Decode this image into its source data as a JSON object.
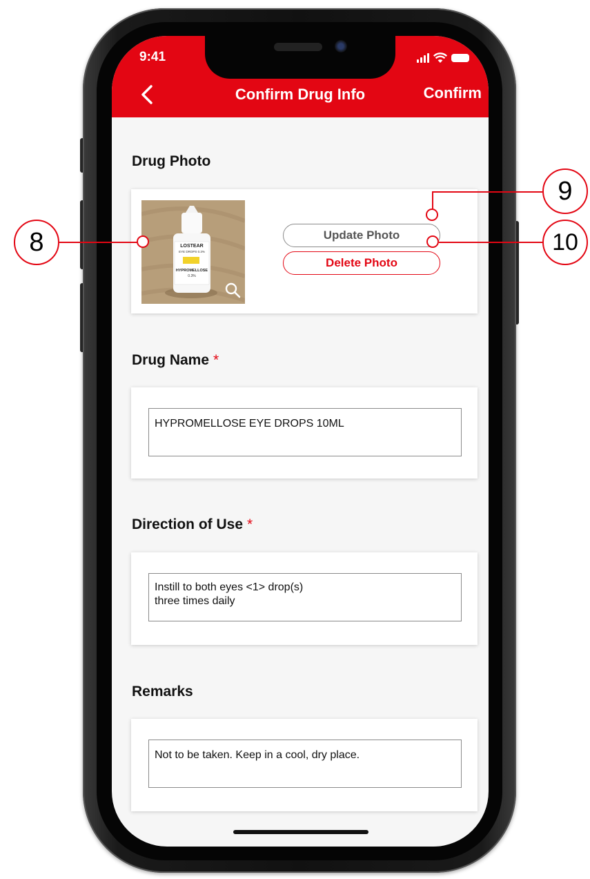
{
  "status_bar": {
    "time": "9:41"
  },
  "nav": {
    "title": "Confirm Drug Info",
    "confirm_label": "Confirm",
    "back_icon": "chevron-left-icon"
  },
  "drug_photo": {
    "title": "Drug Photo",
    "bottle_label_lines": [
      "LOSTEAR",
      "EYE DROPS 0.3%",
      "HYPROMELLOSE",
      "0.3%"
    ],
    "update_label": "Update Photo",
    "delete_label": "Delete Photo"
  },
  "drug_name": {
    "title": "Drug Name",
    "required_mark": "*",
    "value": "HYPROMELLOSE EYE DROPS 10ML"
  },
  "direction": {
    "title": "Direction of Use",
    "required_mark": "*",
    "value": "Instill to both eyes <1> drop(s)\nthree times daily"
  },
  "remarks": {
    "title": "Remarks",
    "value": "Not to be taken. Keep in a cool, dry place."
  },
  "callouts": {
    "photo": "8",
    "update": "9",
    "delete": "10"
  },
  "colors": {
    "brand": "#e30613",
    "background": "#f6f6f6"
  }
}
